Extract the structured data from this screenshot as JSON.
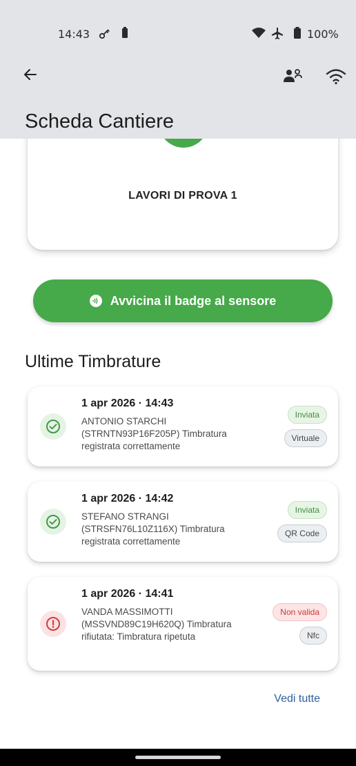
{
  "status_bar": {
    "time": "14:43",
    "battery": "100%",
    "icons": [
      "key-icon",
      "sim-icon",
      "wifi-icon",
      "airplane-icon",
      "battery-icon"
    ]
  },
  "toolbar": {
    "title": "Scheda Cantiere",
    "icons": [
      "back-arrow-icon",
      "people-icon",
      "wifi-icon"
    ]
  },
  "site": {
    "name": "LAVORI DI PROVA 1",
    "accent": "#47a94b"
  },
  "badge_button": {
    "label": "Avvicina il badge al sensore",
    "color": "#46a94a"
  },
  "punches": {
    "title": "Ultime Timbrature",
    "items": [
      {
        "datetime": "1 apr 2026 · 14:43",
        "description": "ANTONIO STARCHI (STRNTN93P16F205P) Timbratura registrata correttamente",
        "status": "ok",
        "status_chip": "Inviata",
        "source_chip": "Virtuale"
      },
      {
        "datetime": "1 apr 2026 · 14:42",
        "description": "STEFANO STRANGI (STRSFN76L10Z116X) Timbratura registrata correttamente",
        "status": "ok",
        "status_chip": "Inviata",
        "source_chip": "QR Code"
      },
      {
        "datetime": "1 apr 2026 · 14:41",
        "description": "VANDA MASSIMOTTI (MSSVND89C19H620Q) Timbratura rifiutata: Timbratura ripetuta",
        "status": "error",
        "status_chip": "Non valida",
        "source_chip": "Nfc"
      }
    ],
    "see_all": "Vedi tutte"
  },
  "colors": {
    "ok": "#3f9a45",
    "error": "#d23c3c",
    "link": "#2a5e9e",
    "appbar": "#e2e4e8"
  }
}
